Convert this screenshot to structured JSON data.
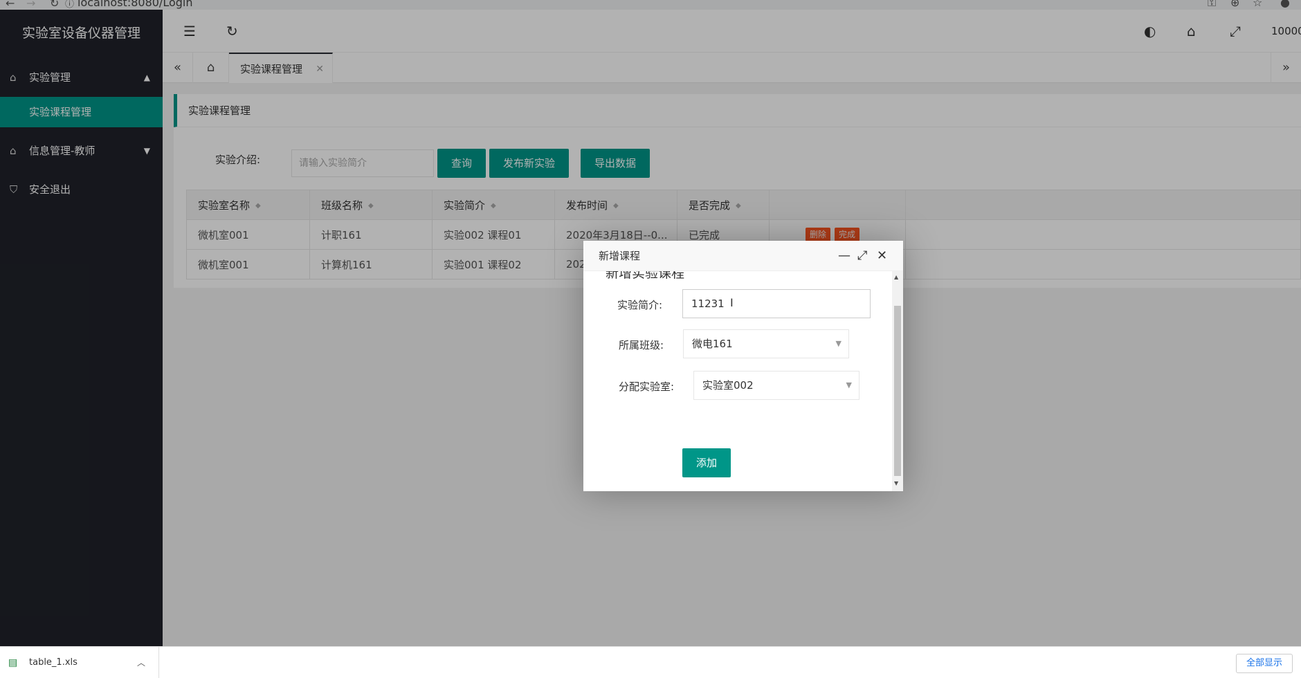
{
  "browser": {
    "url": "localhost:8080/Login"
  },
  "sidebar": {
    "title": "实验室设备仪器管理",
    "menu": [
      {
        "label": "实验管理"
      },
      {
        "label": "实验课程管理"
      },
      {
        "label": "信息管理-教师"
      },
      {
        "label": "安全退出"
      }
    ]
  },
  "header": {
    "user": "10000"
  },
  "tabs": {
    "active": "实验课程管理"
  },
  "content": {
    "card_title": "实验课程管理",
    "search_label": "实验介绍:",
    "search_placeholder": "请输入实验简介",
    "btn_query": "查询",
    "btn_publish": "发布新实验",
    "btn_export": "导出数据"
  },
  "table": {
    "headers": [
      "实验室名称",
      "班级名称",
      "实验简介",
      "发布时间",
      "是否完成"
    ],
    "rows": [
      {
        "lab": "微机室001",
        "cls": "计职161",
        "intro": "实验002 课程01",
        "time": "2020年3月18日--0...",
        "done": "已完成",
        "delete": "删除",
        "finish": "完成"
      },
      {
        "lab": "微机室001",
        "cls": "计算机161",
        "intro": "实验001 课程02",
        "time": "202",
        "done": "",
        "delete": "",
        "finish": ""
      }
    ]
  },
  "modal": {
    "title": "新增课程",
    "cut_title": "新增实验课程",
    "intro_label": "实验简介:",
    "intro_value": "11231",
    "class_label": "所属班级:",
    "class_value": "微电161",
    "lab_label": "分配实验室:",
    "lab_value": "实验室002",
    "submit": "添加"
  },
  "download": {
    "file": "table_1.xls",
    "show_all": "全部显示"
  }
}
